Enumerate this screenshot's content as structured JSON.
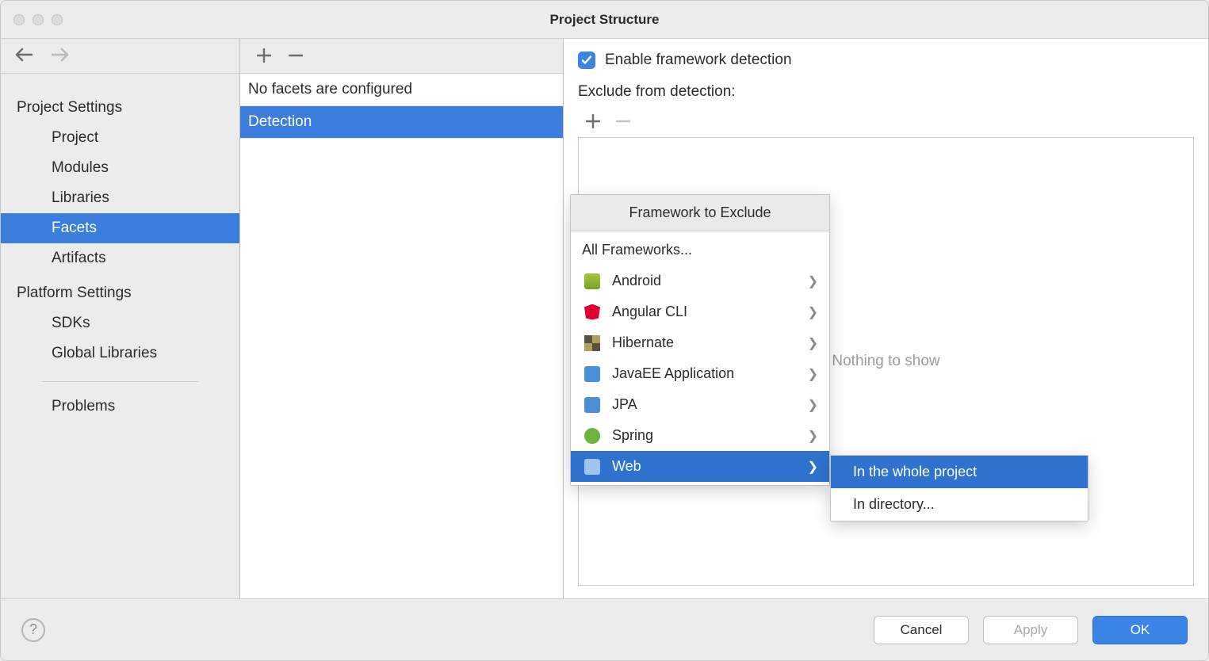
{
  "window": {
    "title": "Project Structure"
  },
  "sidebar": {
    "section1": "Project Settings",
    "items1": [
      {
        "label": "Project"
      },
      {
        "label": "Modules"
      },
      {
        "label": "Libraries"
      },
      {
        "label": "Facets",
        "selected": true
      },
      {
        "label": "Artifacts"
      }
    ],
    "section2": "Platform Settings",
    "items2": [
      {
        "label": "SDKs"
      },
      {
        "label": "Global Libraries"
      }
    ],
    "items3": [
      {
        "label": "Problems"
      }
    ]
  },
  "middle": {
    "empty_label": "No facets are configured",
    "rows": [
      {
        "label": "Detection",
        "selected": true
      }
    ]
  },
  "right": {
    "enable_label": "Enable framework detection",
    "enable_checked": true,
    "exclude_label": "Exclude from detection:",
    "placeholder": "Nothing to show"
  },
  "popup": {
    "header": "Framework to Exclude",
    "all_label": "All Frameworks...",
    "items": [
      {
        "label": "Android",
        "icon": "android"
      },
      {
        "label": "Angular CLI",
        "icon": "angular"
      },
      {
        "label": "Hibernate",
        "icon": "hibernate"
      },
      {
        "label": "JavaEE Application",
        "icon": "javaee"
      },
      {
        "label": "JPA",
        "icon": "jpa"
      },
      {
        "label": "Spring",
        "icon": "spring"
      },
      {
        "label": "Web",
        "icon": "web",
        "selected": true
      }
    ]
  },
  "submenu": {
    "items": [
      {
        "label": "In the whole project",
        "selected": true
      },
      {
        "label": "In directory..."
      }
    ]
  },
  "footer": {
    "cancel": "Cancel",
    "apply": "Apply",
    "ok": "OK"
  }
}
